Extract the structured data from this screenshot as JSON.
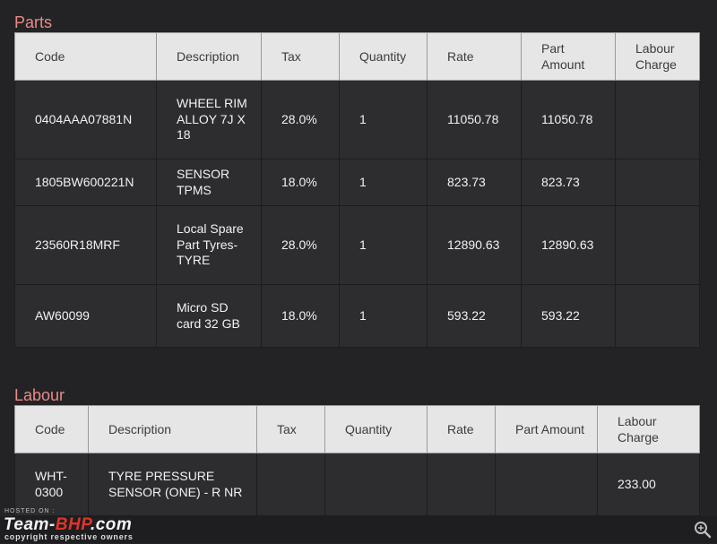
{
  "parts": {
    "title": "Parts",
    "headers": [
      "Code",
      "Description",
      "Tax",
      "Quantity",
      "Rate",
      "Part Amount",
      "Labour Charge"
    ],
    "rows": [
      {
        "code": "0404AAA07881N",
        "description": "WHEEL RIM ALLOY 7J X 18",
        "tax": "28.0%",
        "quantity": "1",
        "rate": "11050.78",
        "part_amount": "11050.78",
        "labour_charge": ""
      },
      {
        "code": "1805BW600221N",
        "description": "SENSOR TPMS",
        "tax": "18.0%",
        "quantity": "1",
        "rate": "823.73",
        "part_amount": "823.73",
        "labour_charge": ""
      },
      {
        "code": "23560R18MRF",
        "description": "Local Spare Part Tyres-TYRE",
        "tax": "28.0%",
        "quantity": "1",
        "rate": "12890.63",
        "part_amount": "12890.63",
        "labour_charge": ""
      },
      {
        "code": "AW60099",
        "description": "Micro SD card 32 GB",
        "tax": "18.0%",
        "quantity": "1",
        "rate": "593.22",
        "part_amount": "593.22",
        "labour_charge": ""
      }
    ]
  },
  "labour": {
    "title": "Labour",
    "headers": [
      "Code",
      "Description",
      "Tax",
      "Quantity",
      "Rate",
      "Part Amount",
      "Labour Charge"
    ],
    "rows": [
      {
        "code": "WHT-0300",
        "description": "TYRE PRESSURE SENSOR (ONE) - R NR",
        "tax": "",
        "quantity": "",
        "rate": "",
        "part_amount": "",
        "labour_charge": "233.00"
      }
    ]
  },
  "watermark": {
    "hosted_on": "HOSTED ON :",
    "logo_main": "Team-",
    "logo_accent": "BHP",
    "logo_tail": ".com",
    "copyright": "copyright respective owners"
  },
  "icons": {
    "zoom": "zoom-icon"
  },
  "colors": {
    "section_title": "#e98a87",
    "header_bg": "#e6e6e6",
    "row_bg": "#2d2d2f",
    "page_bg": "#232325",
    "logo_accent": "#e0352b"
  }
}
